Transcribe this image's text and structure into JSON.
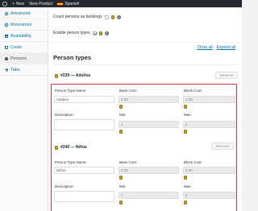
{
  "adminbar": {
    "new_label": "New",
    "view_label": "View Product",
    "language": "Spanish"
  },
  "sidebar": {
    "items": [
      {
        "label": "Advanced",
        "icon": "gear-icon"
      },
      {
        "label": "Resources",
        "icon": "link-icon"
      },
      {
        "label": "Availability",
        "icon": "calendar-icon"
      },
      {
        "label": "Costs",
        "icon": "money-icon"
      },
      {
        "label": "Persons",
        "icon": "users-icon",
        "active": true
      },
      {
        "label": "Tabs",
        "icon": "plus-icon"
      }
    ]
  },
  "options": {
    "count_persons_label": "Count persons as bookings",
    "enable_types_label": "Enable person types"
  },
  "section": {
    "title": "Person types",
    "close_all": "Close all",
    "expand_all": "Expand all"
  },
  "person_types": [
    {
      "title": "#239 — Adultos",
      "remove_label": "Remove",
      "name_label": "Person Type Name:",
      "name_value": "Adultos",
      "base_cost_label": "Base Cost:",
      "base_cost_value": "0.00",
      "block_cost_label": "Block Cost:",
      "block_cost_value": "0.00",
      "description_label": "Description:",
      "min_label": "Min:",
      "min_value": "1",
      "max_label": "Max:",
      "max_value": "4"
    },
    {
      "title": "#240 — Niños",
      "remove_label": "Remove",
      "name_label": "Person Type Name:",
      "name_value": "Niños",
      "base_cost_label": "Base Cost:",
      "base_cost_value": "0.00",
      "block_cost_label": "Block Cost:",
      "block_cost_value": "0.00",
      "description_label": "Description:",
      "min_label": "Min:",
      "min_value": "1",
      "max_label": "Max:",
      "max_value": "2"
    }
  ]
}
